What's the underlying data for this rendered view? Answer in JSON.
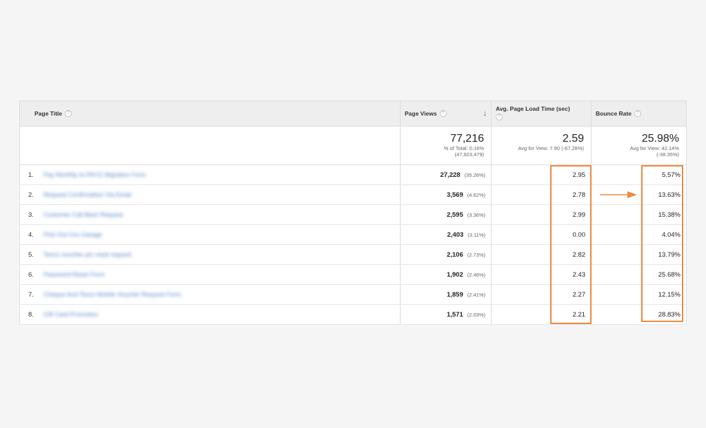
{
  "columns": {
    "page_title": "Page Title",
    "page_views": "Page Views",
    "avg_load_time": "Avg. Page Load Time (sec)",
    "bounce_rate": "Bounce Rate"
  },
  "help_glyph": "?",
  "sort_glyph": "↓",
  "totals": {
    "page_views": "77,216",
    "page_views_sub1": "% of Total: 0.16%",
    "page_views_sub2": "(47,923,479)",
    "avg_load_time": "2.59",
    "avg_load_time_sub": "Avg for View: 7.90 (-67.28%)",
    "bounce_rate": "25.98%",
    "bounce_rate_sub1": "Avg for View: 42.14%",
    "bounce_rate_sub2": "(-38.35%)"
  },
  "rows": [
    {
      "num": "1.",
      "title": "Pay Monthly to PAYG Migration Form",
      "views": "27,228",
      "pct": "(35.26%)",
      "load": "2.95",
      "bounce": "5.57%"
    },
    {
      "num": "2.",
      "title": "Request Confirmation Via Email",
      "views": "3,569",
      "pct": "(4.62%)",
      "load": "2.78",
      "bounce": "13.63%"
    },
    {
      "num": "3.",
      "title": "Customer Call Back Request",
      "views": "2,595",
      "pct": "(3.36%)",
      "load": "2.99",
      "bounce": "15.38%"
    },
    {
      "num": "4.",
      "title": "Pick Out Cov Garage",
      "views": "2,403",
      "pct": "(3.11%)",
      "load": "0.00",
      "bounce": "4.04%"
    },
    {
      "num": "5.",
      "title": "Tesco voucher pin reset request",
      "views": "2,106",
      "pct": "(2.73%)",
      "load": "2.82",
      "bounce": "13.79%"
    },
    {
      "num": "6.",
      "title": "Password Reset Form",
      "views": "1,902",
      "pct": "(2.46%)",
      "load": "2.43",
      "bounce": "25.68%"
    },
    {
      "num": "7.",
      "title": "Cheque And Tesco Mobile Voucher Request Form",
      "views": "1,859",
      "pct": "(2.41%)",
      "load": "2.27",
      "bounce": "12.15%"
    },
    {
      "num": "8.",
      "title": "Gift Card Promotion",
      "views": "1,571",
      "pct": "(2.03%)",
      "load": "2.21",
      "bounce": "28.83%"
    }
  ],
  "annotation_color": "#f0883d"
}
